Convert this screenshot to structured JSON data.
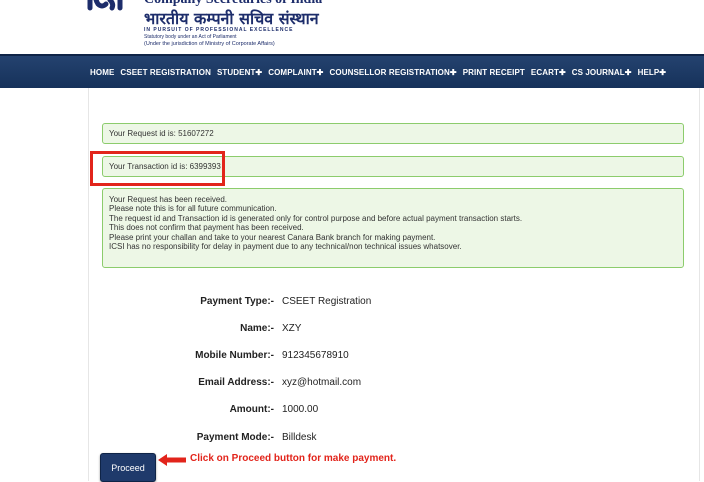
{
  "header": {
    "org_name_en": "Company Secretaries of India",
    "org_name_hi": "भारतीय कम्पनी सचिव संस्थान",
    "tagline": "IN PURSUIT OF PROFESSIONAL EXCELLENCE",
    "statutory": "Statutory body under an Act of Parliament",
    "jurisdiction": "(Under the jurisdiction of Ministry of Corporate Affairs)"
  },
  "nav": {
    "items": [
      "HOME",
      "CSEET REGISTRATION",
      "STUDENT✚",
      "COMPLAINT✚",
      "COUNSELLOR REGISTRATION✚",
      "PRINT RECEIPT",
      "ECART✚",
      "CS JOURNAL✚",
      "HELP✚"
    ]
  },
  "messages": {
    "request_id": "Your Request id is: 51607272",
    "transaction_id": "Your Transaction id is: 6399393",
    "notice_lines": [
      "Your Request has been received.",
      "Please note this is for all future communication.",
      "The request id and Transaction id is generated only for control purpose and before actual payment transaction starts.",
      "This does not confirm that payment has been received.",
      "Please print your challan and take to your nearest Canara Bank branch for making payment.",
      "ICSI has no responsibility for delay in payment due to any technical/non technical issues whatsover."
    ]
  },
  "details": [
    {
      "label": "Payment Type:-",
      "value": "CSEET Registration"
    },
    {
      "label": "Name:-",
      "value": "XZY"
    },
    {
      "label": "Mobile Number:-",
      "value": "912345678910"
    },
    {
      "label": "Email Address:-",
      "value": "xyz@hotmail.com"
    },
    {
      "label": "Amount:-",
      "value": "1000.00"
    },
    {
      "label": "Payment Mode:-",
      "value": "Billdesk"
    }
  ],
  "proceed_label": "Proceed",
  "annotation": "Click on Proceed button for make payment."
}
